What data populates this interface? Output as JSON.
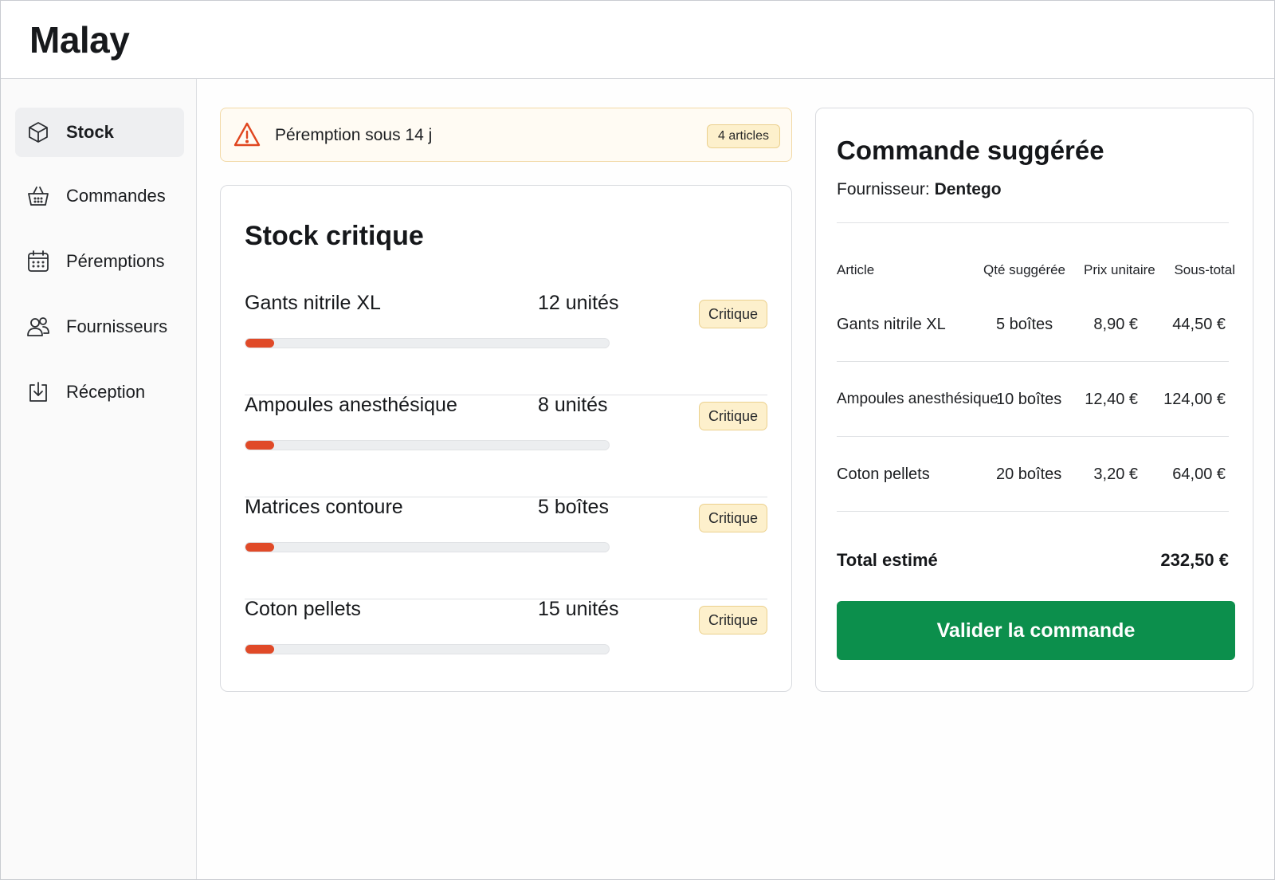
{
  "app": {
    "title": "Malay"
  },
  "sidebar": {
    "items": [
      {
        "label": "Stock",
        "icon": "box-icon",
        "active": true
      },
      {
        "label": "Commandes",
        "icon": "basket-icon"
      },
      {
        "label": "Péremptions",
        "icon": "calendar-icon"
      },
      {
        "label": "Fournisseurs",
        "icon": "users-icon"
      },
      {
        "label": "Réception",
        "icon": "download-tray-icon"
      }
    ]
  },
  "alert": {
    "icon": "warning-triangle-icon",
    "text": "Péremption sous 14 j",
    "badge": "4 articles"
  },
  "stock": {
    "title": "Stock critique",
    "items": [
      {
        "name": "Gants nitrile XL",
        "qty": "12 unités",
        "status": "Critique",
        "level": 0.08
      },
      {
        "name": "Ampoules anesthésique",
        "qty": "8 unités",
        "status": "Critique",
        "level": 0.08
      },
      {
        "name": "Matrices contoure",
        "qty": "5 boîtes",
        "status": "Critique",
        "level": 0.08
      },
      {
        "name": "Coton pellets",
        "qty": "15 unités",
        "status": "Critique",
        "level": 0.08
      }
    ]
  },
  "order": {
    "title": "Commande suggérée",
    "supplier_label": "Fournisseur:",
    "supplier_name": "Dentego",
    "headers": {
      "article": "Article",
      "qty": "Qté suggérée",
      "unit_price": "Prix unitaire",
      "subtotal": "Sous-total"
    },
    "rows": [
      {
        "article": "Gants nitrile XL",
        "qty": "5 boîtes",
        "unit_price": "8,90 €",
        "subtotal": "44,50 €"
      },
      {
        "article": "Ampoules anesthésique",
        "qty": "10 boîtes",
        "unit_price": "12,40 €",
        "subtotal": "124,00 €"
      },
      {
        "article": "Coton pellets",
        "qty": "20 boîtes",
        "unit_price": "3,20 €",
        "subtotal": "64,00 €"
      }
    ],
    "total_label": "Total estimé",
    "total_value": "232,50 €",
    "validate_label": "Valider la commande"
  },
  "colors": {
    "accent_green": "#0c8f4c",
    "critical_red": "#e04a28",
    "badge_yellow": "#fdf0cc",
    "alert_orange": "#e0461f"
  }
}
